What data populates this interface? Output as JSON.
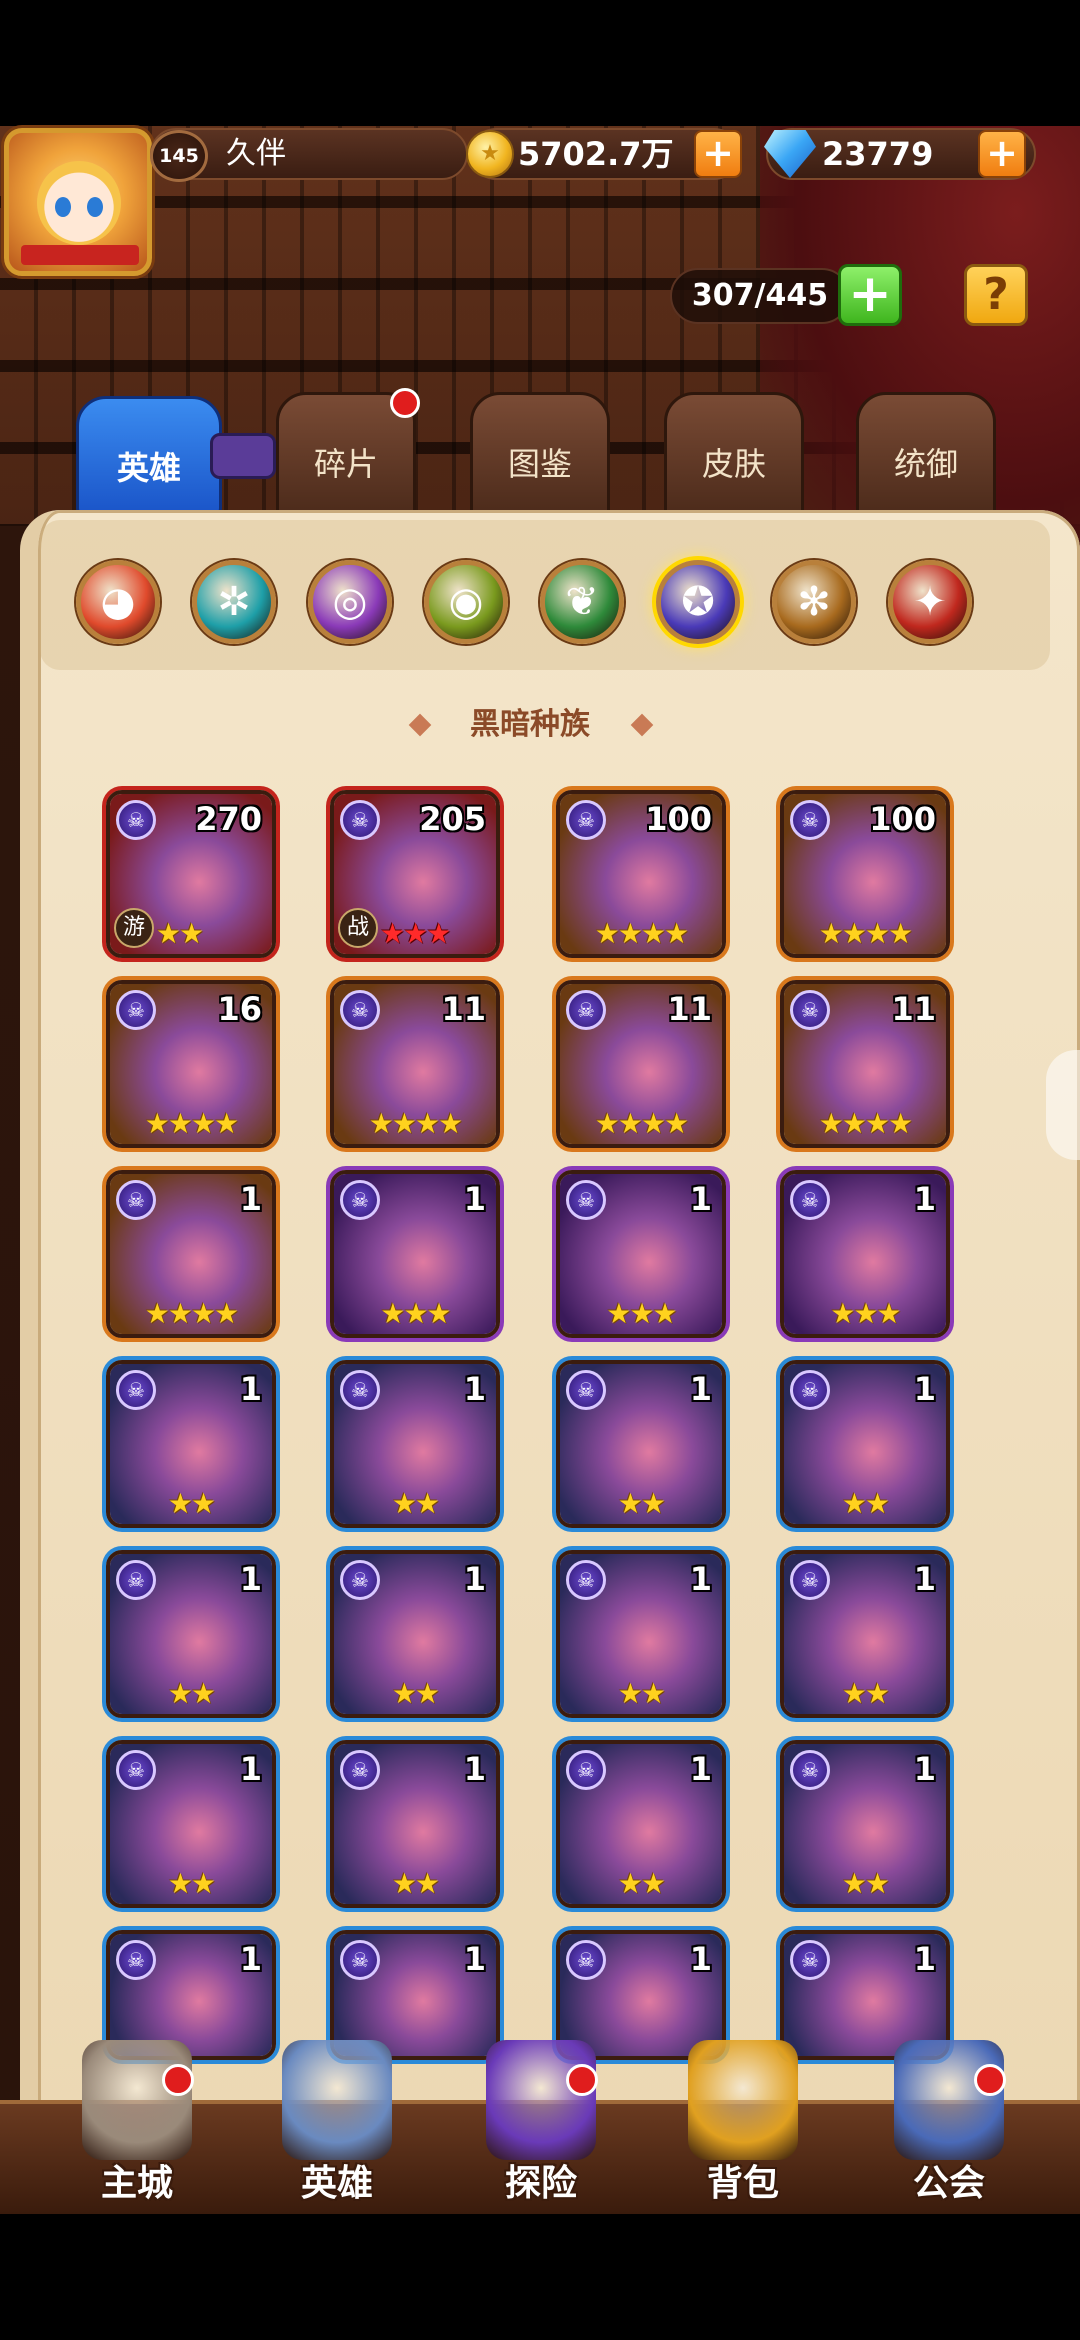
{
  "player": {
    "level": "145",
    "name": "久伴",
    "gold": "5702.7万",
    "gems": "23779"
  },
  "hero_capacity": "307/445",
  "tabs": [
    {
      "label": "英雄",
      "active": true
    },
    {
      "label": "碎片",
      "active": false,
      "notification": true
    },
    {
      "label": "图鉴",
      "active": false
    },
    {
      "label": "皮肤",
      "active": false
    },
    {
      "label": "统御",
      "active": false
    }
  ],
  "categories": [
    {
      "icon": "all-races-icon",
      "color": "#e04a2c"
    },
    {
      "icon": "fortress-icon",
      "color": "#1e9fa8"
    },
    {
      "icon": "abyss-icon",
      "color": "#8a3ab8"
    },
    {
      "icon": "forest-icon",
      "color": "#7a9a1e"
    },
    {
      "icon": "shadow-icon",
      "color": "#2e8a3a"
    },
    {
      "icon": "dark-race-icon",
      "color": "#4a3ab8",
      "active": true
    },
    {
      "icon": "light-icon",
      "color": "#a86a1e"
    },
    {
      "icon": "fire-icon",
      "color": "#c0281e"
    }
  ],
  "section_title": "黑暗种族",
  "heroes": [
    {
      "level": "270",
      "stars": "★★",
      "role": "游",
      "star_color": "yellow",
      "frame": "red"
    },
    {
      "level": "205",
      "stars": "★★★",
      "role": "战",
      "star_color": "red",
      "frame": "red"
    },
    {
      "level": "100",
      "stars": "★★★★",
      "star_color": "yellow",
      "frame": "orange"
    },
    {
      "level": "100",
      "stars": "★★★★",
      "star_color": "yellow",
      "frame": "orange"
    },
    {
      "level": "16",
      "stars": "★★★★",
      "star_color": "yellow",
      "frame": "orange"
    },
    {
      "level": "11",
      "stars": "★★★★",
      "star_color": "yellow",
      "frame": "orange"
    },
    {
      "level": "11",
      "stars": "★★★★",
      "star_color": "yellow",
      "frame": "orange"
    },
    {
      "level": "11",
      "stars": "★★★★",
      "star_color": "yellow",
      "frame": "orange"
    },
    {
      "level": "1",
      "stars": "★★★★",
      "star_color": "yellow",
      "frame": "orange"
    },
    {
      "level": "1",
      "stars": "★★★",
      "star_color": "yellow",
      "frame": "purple"
    },
    {
      "level": "1",
      "stars": "★★★",
      "star_color": "yellow",
      "frame": "purple"
    },
    {
      "level": "1",
      "stars": "★★★",
      "star_color": "yellow",
      "frame": "purple"
    },
    {
      "level": "1",
      "stars": "★★",
      "star_color": "yellow",
      "frame": "blue"
    },
    {
      "level": "1",
      "stars": "★★",
      "star_color": "yellow",
      "frame": "blue"
    },
    {
      "level": "1",
      "stars": "★★",
      "star_color": "yellow",
      "frame": "blue"
    },
    {
      "level": "1",
      "stars": "★★",
      "star_color": "yellow",
      "frame": "blue"
    },
    {
      "level": "1",
      "stars": "★★",
      "star_color": "yellow",
      "frame": "blue"
    },
    {
      "level": "1",
      "stars": "★★",
      "star_color": "yellow",
      "frame": "blue"
    },
    {
      "level": "1",
      "stars": "★★",
      "star_color": "yellow",
      "frame": "blue"
    },
    {
      "level": "1",
      "stars": "★★",
      "star_color": "yellow",
      "frame": "blue"
    },
    {
      "level": "1",
      "stars": "★★",
      "star_color": "yellow",
      "frame": "blue"
    },
    {
      "level": "1",
      "stars": "★★",
      "star_color": "yellow",
      "frame": "blue"
    },
    {
      "level": "1",
      "stars": "★★",
      "star_color": "yellow",
      "frame": "blue"
    },
    {
      "level": "1",
      "stars": "★★",
      "star_color": "yellow",
      "frame": "blue"
    },
    {
      "level": "1",
      "stars": "",
      "star_color": "yellow",
      "frame": "blue"
    },
    {
      "level": "1",
      "stars": "",
      "star_color": "yellow",
      "frame": "blue"
    },
    {
      "level": "1",
      "stars": "",
      "star_color": "yellow",
      "frame": "blue"
    },
    {
      "level": "1",
      "stars": "",
      "star_color": "yellow",
      "frame": "blue"
    }
  ],
  "bottom_nav": [
    {
      "label": "主城",
      "icon": "castle-icon",
      "notification": true
    },
    {
      "label": "英雄",
      "icon": "hero-portrait-icon",
      "notification": false
    },
    {
      "label": "探险",
      "icon": "portal-icon",
      "notification": true
    },
    {
      "label": "背包",
      "icon": "backpack-icon",
      "notification": false
    },
    {
      "label": "公会",
      "icon": "guild-icon",
      "notification": true
    }
  ],
  "colors": {
    "panel": "#f4e6cb",
    "tab_active": "#2a6fe0",
    "tab_inactive": "#6a3f2b",
    "accent_orange": "#f07d10",
    "accent_green": "#3fb51e"
  }
}
